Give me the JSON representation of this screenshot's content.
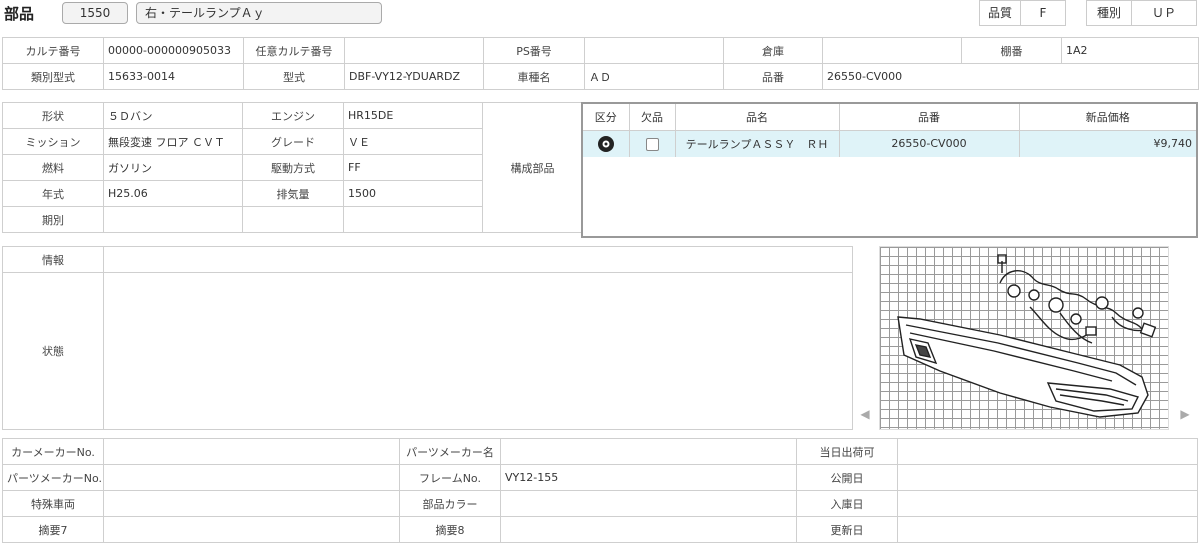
{
  "header": {
    "title": "部品",
    "code": "1550",
    "name": "右・テールランプＡｙ",
    "quality_label": "品質",
    "quality_value": "F",
    "type_label": "種別",
    "type_value": "ＵＰ"
  },
  "row1": {
    "karte_label": "カルテ番号",
    "karte_value": "00000-000000905033",
    "ninni_label": "任意カルテ番号",
    "ninni_value": "",
    "ps_label": "PS番号",
    "ps_value": "",
    "souko_label": "倉庫",
    "souko_value": "",
    "tana_label": "棚番",
    "tana_value": "1A2"
  },
  "row2": {
    "ruibetsu_label": "類別型式",
    "ruibetsu_value": "15633-0014",
    "kata_label": "型式",
    "kata_value": "DBF-VY12-YDUARDZ",
    "shamei_label": "車種名",
    "shamei_value": "ＡＤ",
    "hinban_label": "品番",
    "hinban_value": "26550-CV000"
  },
  "spec": {
    "katachi_label": "形状",
    "katachi_value": "５Ｄバン",
    "engine_label": "エンジン",
    "engine_value": "HR15DE",
    "mission_label": "ミッション",
    "mission_value": "無段変速 フロア ＣＶＴ",
    "grade_label": "グレード",
    "grade_value": "ＶＥ",
    "fuel_label": "燃料",
    "fuel_value": "ガソリン",
    "drive_label": "駆動方式",
    "drive_value": "FF",
    "year_label": "年式",
    "year_value": "H25.06",
    "disp_label": "排気量",
    "disp_value": "1500",
    "period_label": "期別",
    "period_value": "",
    "kosei_label": "構成部品"
  },
  "parts_table": {
    "headers": [
      "区分",
      "欠品",
      "品名",
      "品番",
      "新品価格"
    ],
    "rows": [
      {
        "icon": "tire-icon",
        "name": "テールランプＡＳＳＹ　ＲＨ",
        "number": "26550-CV000",
        "price": "¥9,740"
      }
    ]
  },
  "info": {
    "joho_label": "情報",
    "joho_value": "",
    "jotai_label": "状態",
    "jotai_value": ""
  },
  "bottom": {
    "carmaker_label": "カーメーカーNo.",
    "carmaker_value": "",
    "partsmakername_label": "パーツメーカー名",
    "partsmakername_value": "",
    "touji_label": "当日出荷可",
    "touji_value": "",
    "partsmakerno_label": "パーツメーカーNo.",
    "partsmakerno_value": "",
    "frame_label": "フレームNo.",
    "frame_value": "VY12-155",
    "kokai_label": "公開日",
    "kokai_value": "",
    "tokushu_label": "特殊車両",
    "tokushu_value": "",
    "color_label": "部品カラー",
    "color_value": "",
    "nyuko_label": "入庫日",
    "nyuko_value": "",
    "tekiyo7_label": "摘要7",
    "tekiyo7_value": "",
    "tekiyo8_label": "摘要8",
    "tekiyo8_value": "",
    "koshin_label": "更新日",
    "koshin_value": ""
  },
  "image_panel": {
    "prev_icon": "chevron-left-icon",
    "next_icon": "chevron-right-icon"
  }
}
